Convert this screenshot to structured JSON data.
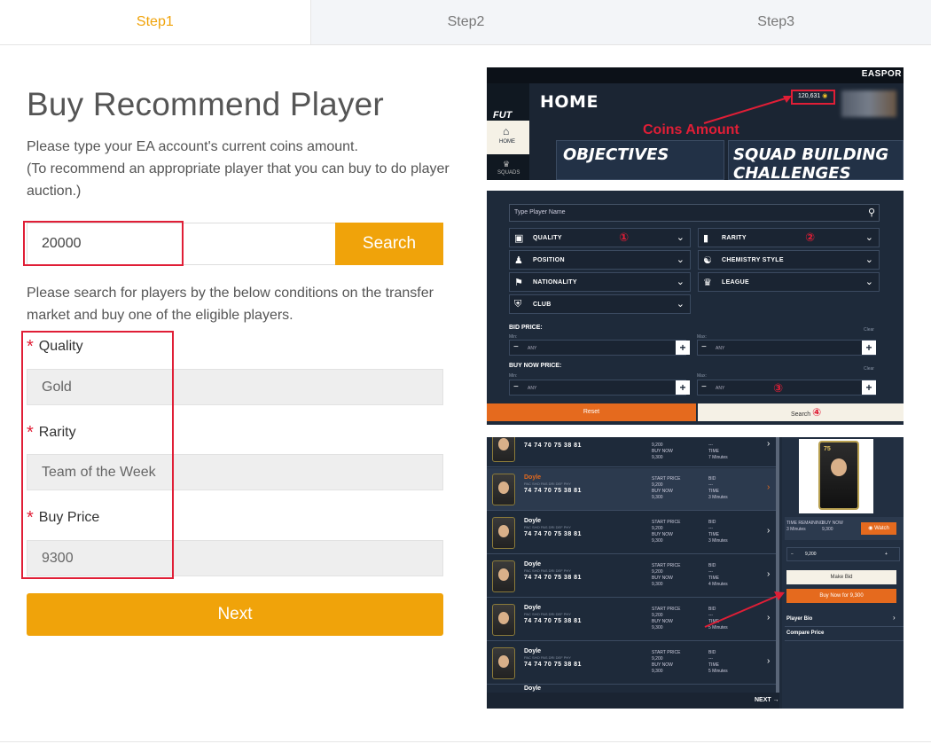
{
  "tabs": [
    "Step1",
    "Step2",
    "Step3"
  ],
  "page": {
    "title": "Buy Recommend Player",
    "intro_line1": "Please type your EA account's current coins amount.",
    "intro_line2": "(To recommend an appropriate player that you can buy to do player auction.)",
    "coins_value": "20000",
    "search_label": "Search",
    "conditions_text": "Please search for players by the below conditions on the transfer market and buy one of the eligible players.",
    "fields": [
      {
        "label": "Quality",
        "value": "Gold"
      },
      {
        "label": "Rarity",
        "value": "Team of the Week"
      },
      {
        "label": "Buy Price",
        "value": "9300"
      }
    ],
    "required_mark": "*",
    "next_label": "Next"
  },
  "colors": {
    "accent": "#f0a30a",
    "highlight_red": "#e01e36",
    "game_bg": "#1e2a3a",
    "game_orange": "#e56a1e"
  },
  "shot1": {
    "brand": "EASPOR",
    "fut": "FUT",
    "home_title": "HOME",
    "coins": "120,631",
    "annotation": "Coins Amount",
    "side_home": "HOME",
    "side_squads": "SQUADS",
    "card_objectives": "OBJECTIVES",
    "card_sbc_1": "SQUAD BUILDING",
    "card_sbc_2": "CHALLENGES"
  },
  "shot2": {
    "search_placeholder": "Type Player Name",
    "filters": [
      {
        "label": "QUALITY",
        "icon": "quality-icon"
      },
      {
        "label": "RARITY",
        "icon": "rarity-icon"
      },
      {
        "label": "POSITION",
        "icon": "position-icon"
      },
      {
        "label": "CHEMISTRY STYLE",
        "icon": "chemistry-icon"
      },
      {
        "label": "NATIONALITY",
        "icon": "flag-icon"
      },
      {
        "label": "LEAGUE",
        "icon": "league-icon"
      },
      {
        "label": "CLUB",
        "icon": "club-icon"
      }
    ],
    "marks": [
      "①",
      "②",
      "③",
      "④"
    ],
    "bid_price": "BID PRICE:",
    "buy_now_price": "BUY NOW PRICE:",
    "min": "Min:",
    "max": "Max:",
    "clear": "Clear",
    "any": "ANY",
    "reset": "Reset",
    "search": "Search"
  },
  "shot3": {
    "player_name": "Doyle",
    "stat_headers": "PAC SHO PAS DRI DEF PHY",
    "stats": "74 74 70 75 38 81",
    "start_price_label": "START PRICE",
    "start_price": "9,200",
    "buy_now_label": "BUY NOW",
    "buy_now": "9,300",
    "bid_label": "BID",
    "bid": "---",
    "time_label": "TIME",
    "times": [
      "7 Minutes",
      "3 Minutes",
      "3 Minutes",
      "4 Minutes",
      "5 Minutes",
      "5 Minutes"
    ],
    "rating": "75",
    "time_remaining_label": "TIME REMAINING",
    "time_remaining": "3 Minutes",
    "buy_now_price_label": "BUY NOW",
    "buy_now_price": "9,300",
    "watch": "Watch",
    "stepper_value": "9,200",
    "make_bid": "Make Bid",
    "buy_now_for": "Buy Now for 9,300",
    "player_bio": "Player Bio",
    "compare_price": "Compare Price",
    "next": "NEXT"
  }
}
